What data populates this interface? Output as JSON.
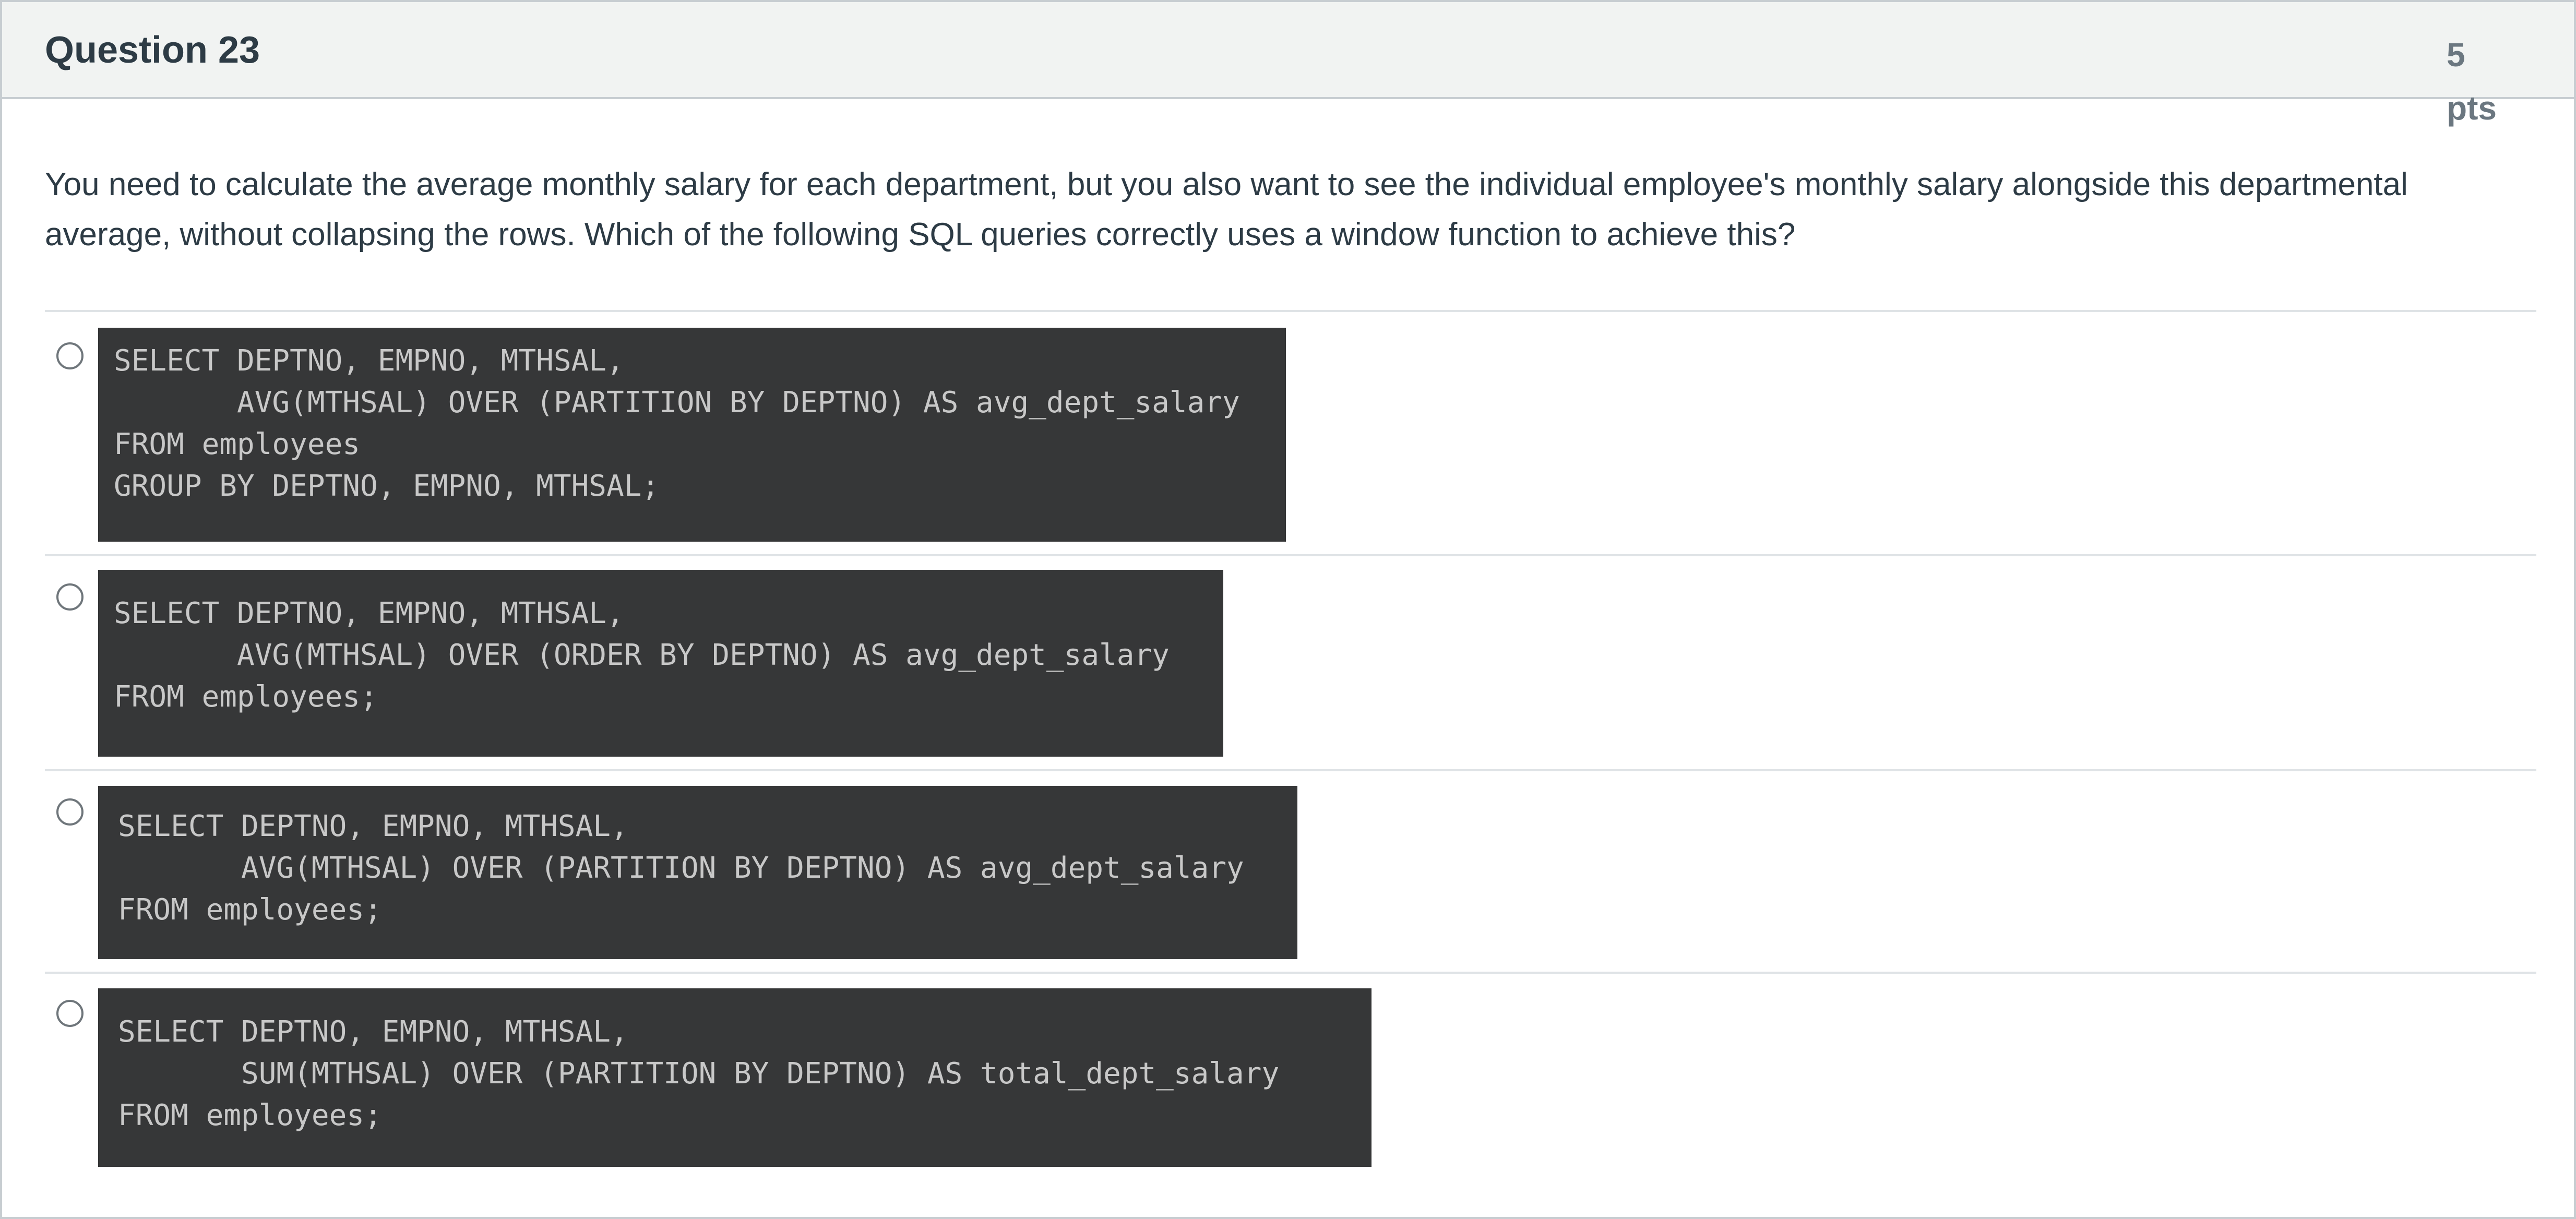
{
  "question": {
    "title": "Question 23",
    "points_value": "5",
    "points_unit": "pts",
    "text": "You need to calculate the average monthly salary for each department, but you also want to see the individual employee's monthly salary alongside this departmental average, without collapsing the rows. Which of the following SQL queries correctly uses a window function to achieve this?"
  },
  "answers": [
    {
      "code": "SELECT DEPTNO, EMPNO, MTHSAL,\n       AVG(MTHSAL) OVER (PARTITION BY DEPTNO) AS avg_dept_salary\nFROM employees\nGROUP BY DEPTNO, EMPNO, MTHSAL;"
    },
    {
      "code": "SELECT DEPTNO, EMPNO, MTHSAL,\n       AVG(MTHSAL) OVER (ORDER BY DEPTNO) AS avg_dept_salary\nFROM employees;"
    },
    {
      "code": "SELECT DEPTNO, EMPNO, MTHSAL,\n       AVG(MTHSAL) OVER (PARTITION BY DEPTNO) AS avg_dept_salary\nFROM employees;"
    },
    {
      "code": "SELECT DEPTNO, EMPNO, MTHSAL,\n       SUM(MTHSAL) OVER (PARTITION BY DEPTNO) AS total_dept_salary\nFROM employees;"
    }
  ]
}
